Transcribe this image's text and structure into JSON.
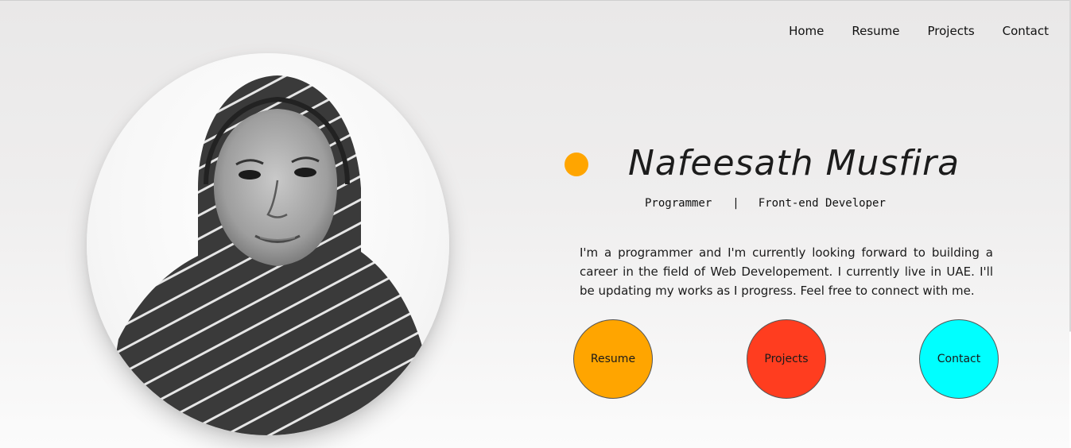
{
  "nav": {
    "items": [
      {
        "label": "Home"
      },
      {
        "label": "Resume"
      },
      {
        "label": "Projects"
      },
      {
        "label": "Contact"
      }
    ]
  },
  "hero": {
    "name": "Nafeesath Musfira",
    "roles": [
      "Programmer",
      "|",
      "Front-end Developer"
    ],
    "intro": "I'm a programmer and I'm currently looking forward to building a career in the field of Web Developement. I currently live in UAE. I'll be updating my works as I progress. Feel free to connect with me.",
    "accent_color": "#ffa500"
  },
  "buttons": [
    {
      "label": "Resume",
      "color": "#ffa500"
    },
    {
      "label": "Projects",
      "color": "#ff3d1f"
    },
    {
      "label": "Contact",
      "color": "#00ffff"
    }
  ]
}
